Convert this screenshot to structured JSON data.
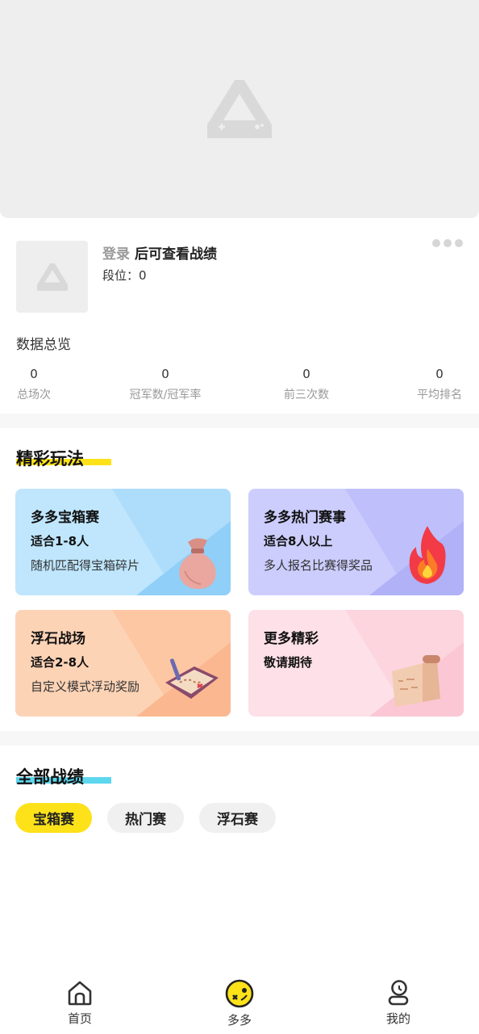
{
  "profile": {
    "login_link": "登录",
    "login_suffix": "后可查看战绩",
    "rank_label": "段位：0"
  },
  "overview": {
    "title": "数据总览",
    "stats": [
      {
        "value": "0",
        "label": "总场次"
      },
      {
        "value": "0",
        "label": "冠军数/冠军率"
      },
      {
        "value": "0",
        "label": "前三次数"
      },
      {
        "value": "0",
        "label": "平均排名"
      }
    ]
  },
  "modes": {
    "title": "精彩玩法",
    "cards": [
      {
        "title": "多多宝箱赛",
        "players": "适合1-8人",
        "desc": "随机匹配得宝箱碎片",
        "icon": "treasure-bag-icon"
      },
      {
        "title": "多多热门赛事",
        "players": "适合8人以上",
        "desc": "多人报名比赛得奖品",
        "icon": "fire-icon"
      },
      {
        "title": "浮石战场",
        "players": "适合2-8人",
        "desc": "自定义模式浮动奖励",
        "icon": "treasure-map-icon"
      },
      {
        "title": "更多精彩",
        "players": "敬请期待",
        "desc": "",
        "icon": "scroll-icon"
      }
    ]
  },
  "records": {
    "title": "全部战绩",
    "filters": [
      {
        "label": "宝箱赛",
        "active": true
      },
      {
        "label": "热门赛",
        "active": false
      },
      {
        "label": "浮石赛",
        "active": false
      }
    ]
  },
  "tabbar": {
    "items": [
      {
        "label": "首页",
        "icon": "home-icon"
      },
      {
        "label": "多多",
        "icon": "duoduo-face-icon"
      },
      {
        "label": "我的",
        "icon": "profile-icon"
      }
    ]
  },
  "colors": {
    "accent_yellow": "#fde21a",
    "accent_cyan": "#5cd7ee",
    "card_blue": "#bfe6fd",
    "card_purple": "#cccdfd",
    "card_orange": "#fdd3b6",
    "card_pink": "#fde0e8"
  }
}
